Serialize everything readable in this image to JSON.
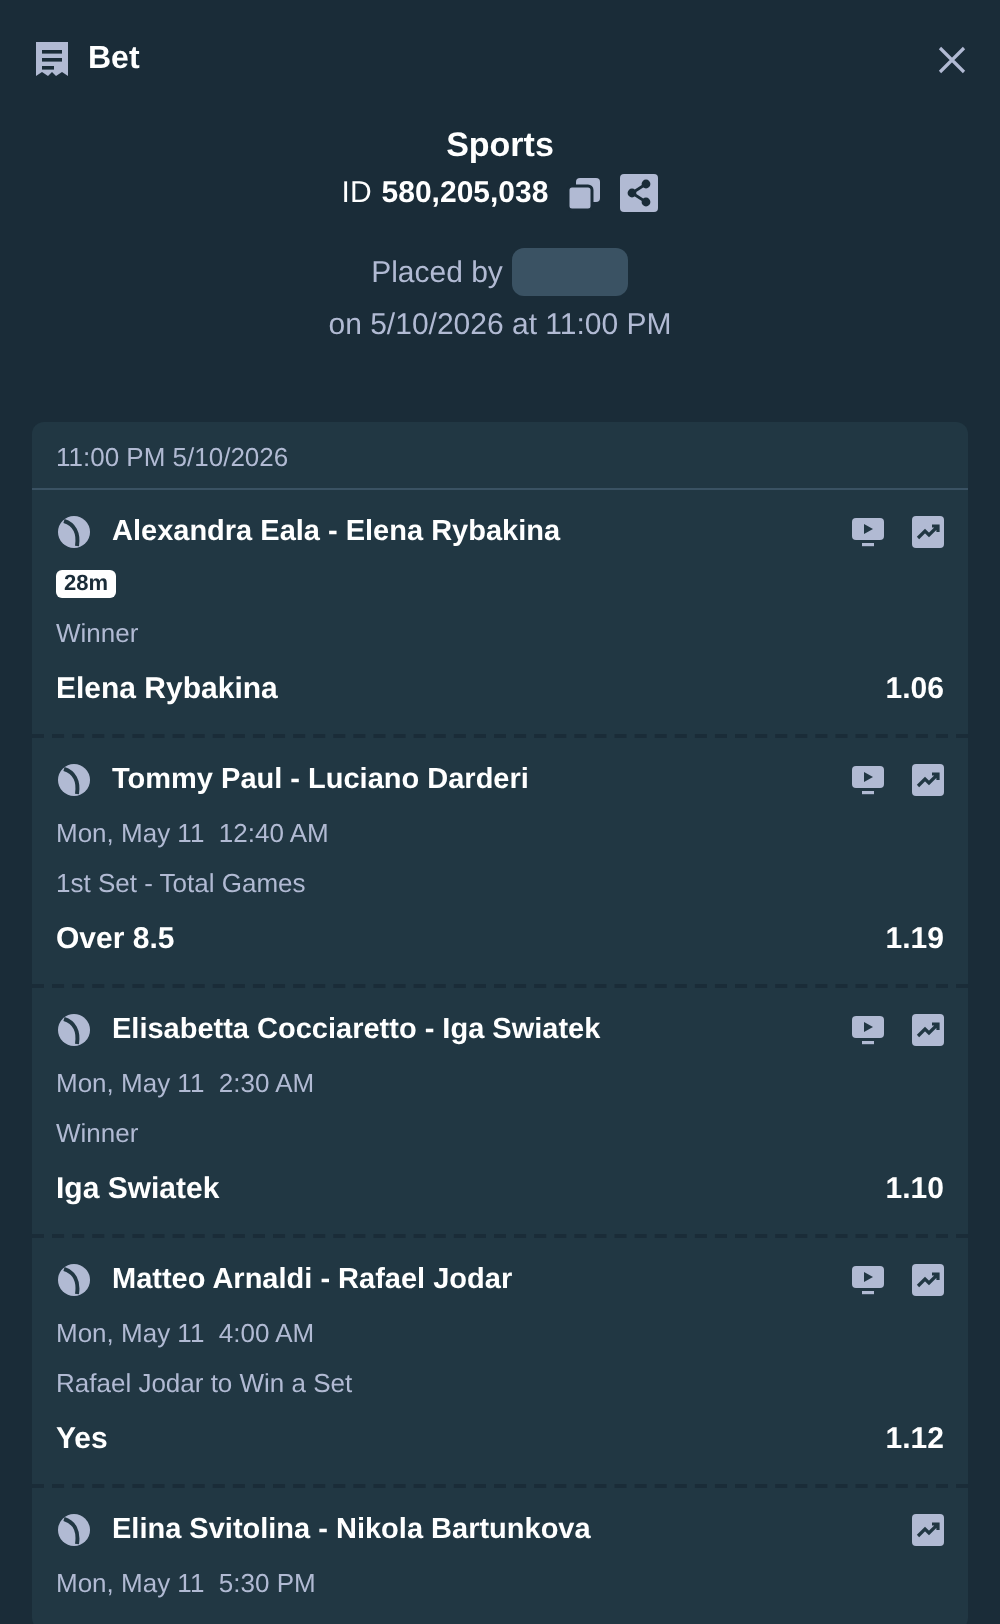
{
  "header": {
    "title": "Bet"
  },
  "summary": {
    "category": "Sports",
    "id_label": "ID",
    "id_value": "580,205,038",
    "placed_by": "Placed by",
    "placed_on": "on 5/10/2026 at 11:00 PM"
  },
  "slip": {
    "time": "11:00 PM 5/10/2026",
    "legs": [
      {
        "match": "Alexandra Eala - Elena Rybakina",
        "stream": true,
        "live": "28m",
        "market": "Winner",
        "selection": "Elena Rybakina",
        "odds": "1.06"
      },
      {
        "match": "Tommy Paul - Luciano Darderi",
        "stream": true,
        "start": "Mon, May 11  12:40 AM",
        "market": "1st Set - Total Games",
        "selection": "Over 8.5",
        "odds": "1.19"
      },
      {
        "match": "Elisabetta Cocciaretto - Iga Swiatek",
        "stream": true,
        "start": "Mon, May 11  2:30 AM",
        "market": "Winner",
        "selection": "Iga Swiatek",
        "odds": "1.10"
      },
      {
        "match": "Matteo Arnaldi - Rafael Jodar",
        "stream": true,
        "start": "Mon, May 11  4:00 AM",
        "market": "Rafael Jodar to Win a Set",
        "selection": "Yes",
        "odds": "1.12"
      },
      {
        "match": "Elina Svitolina - Nikola Bartunkova",
        "stream": false,
        "start": "Mon, May 11  5:30 PM"
      }
    ]
  }
}
